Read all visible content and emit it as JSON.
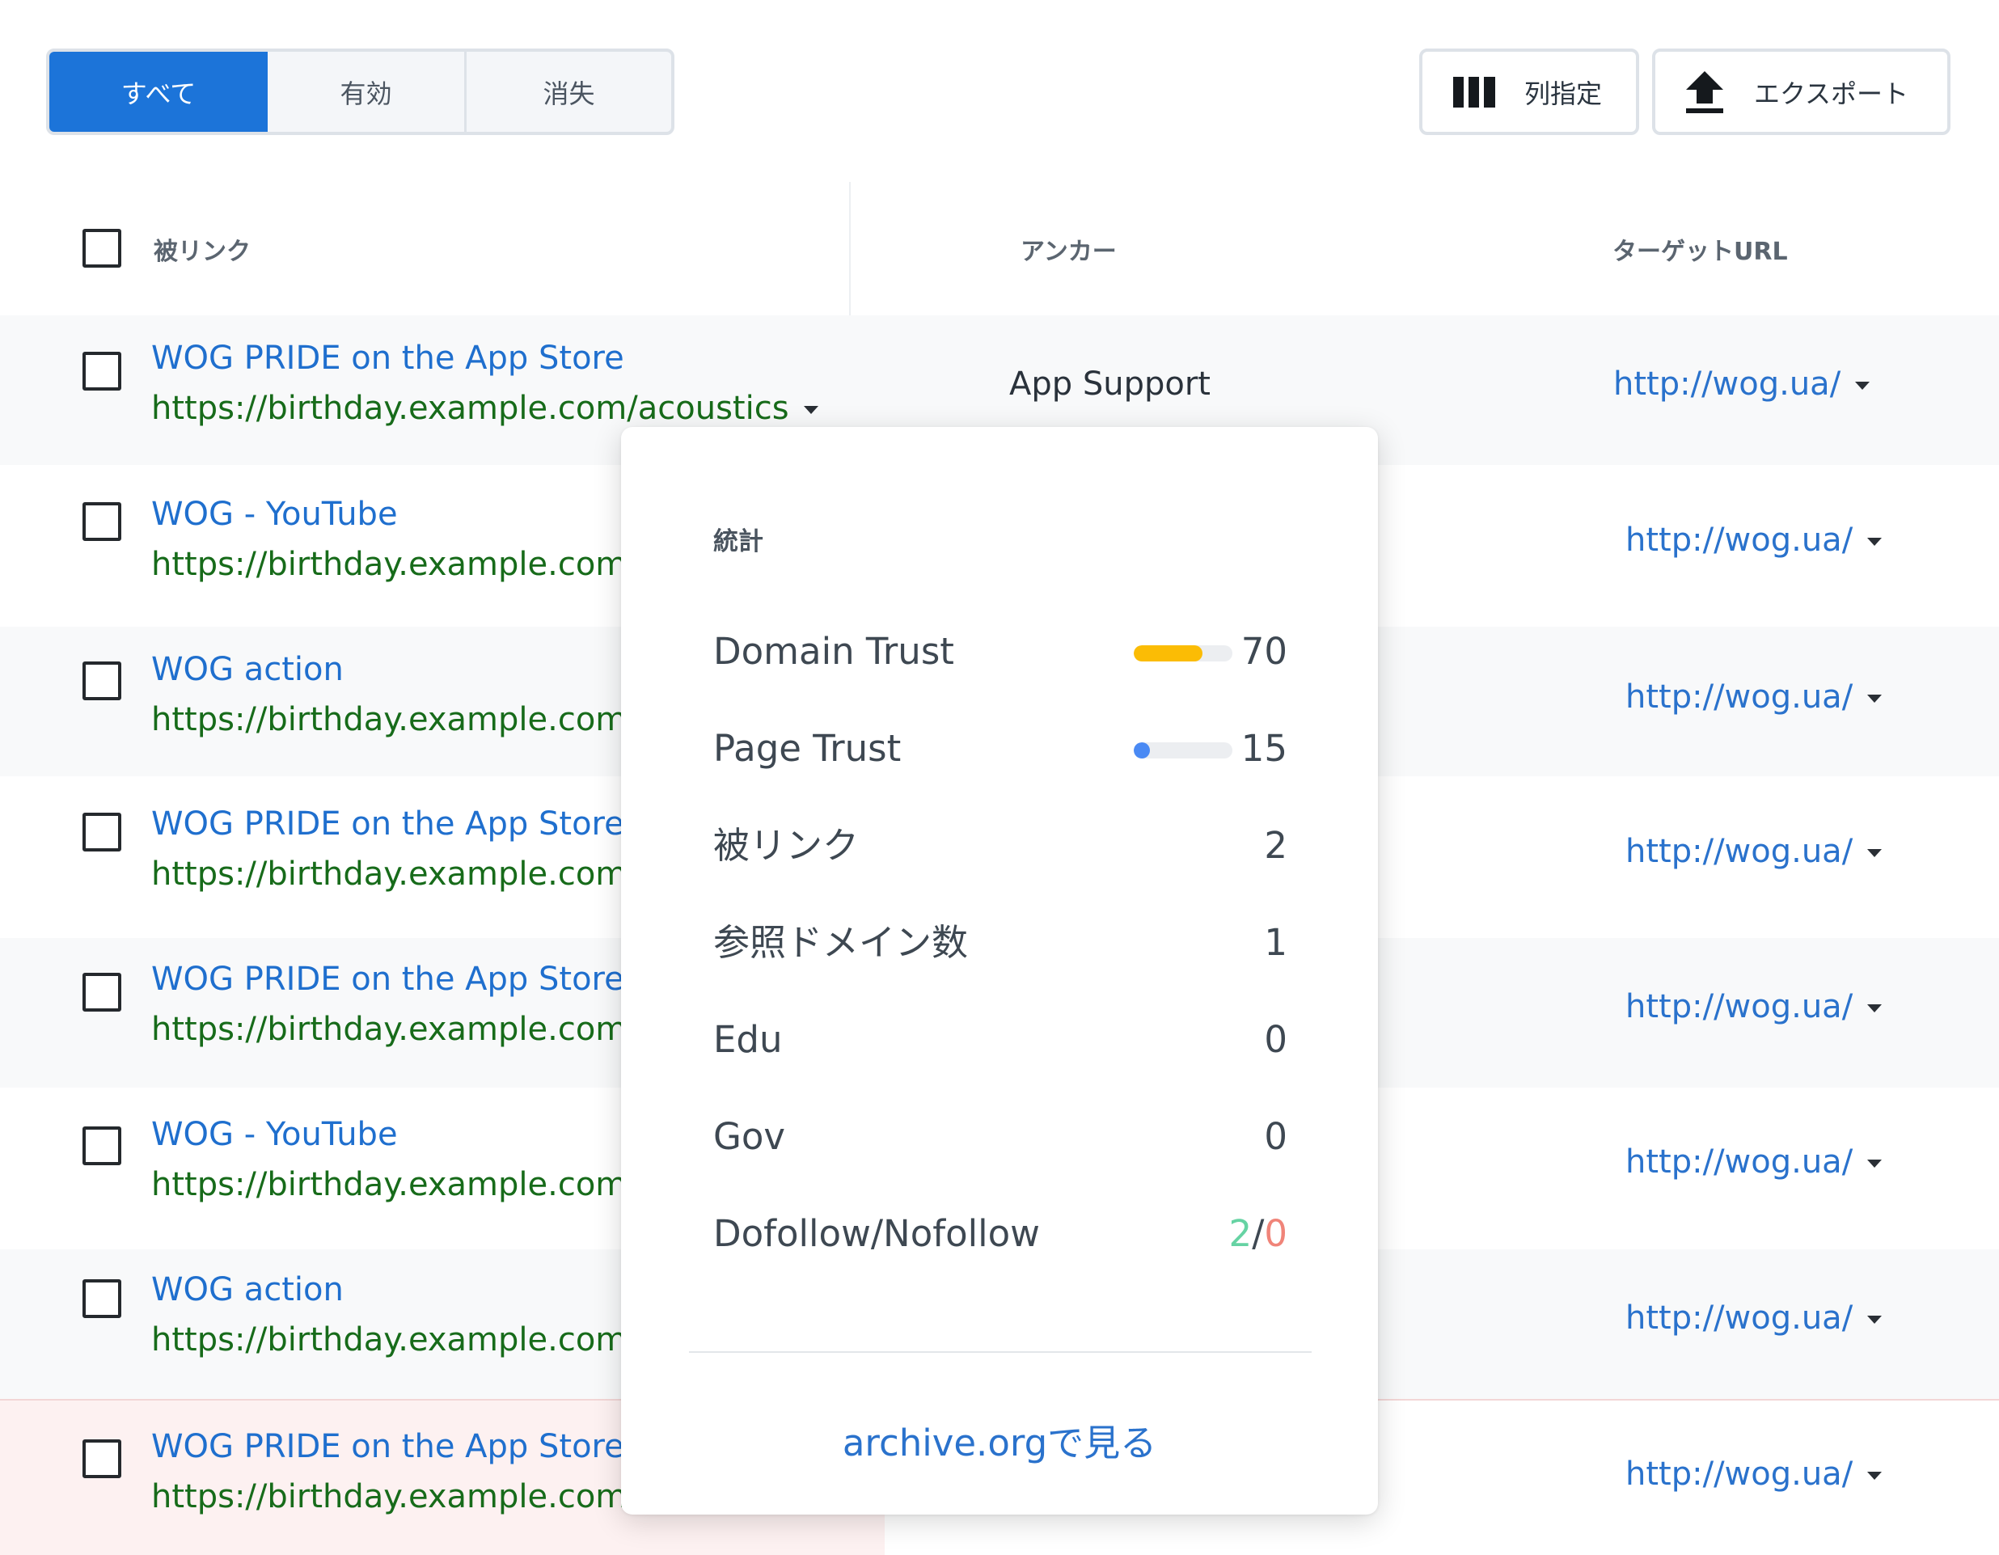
{
  "filter_tabs": [
    {
      "label": "すべて",
      "active": true
    },
    {
      "label": "有効",
      "active": false
    },
    {
      "label": "消失",
      "active": false
    }
  ],
  "toolbar": {
    "columns_label": "列指定",
    "columns_icon": "columns-icon",
    "export_label": "エクスポート",
    "export_icon": "upload-icon"
  },
  "table": {
    "headers": {
      "backlink": "被リンク",
      "anchor": "アンカー",
      "target_url": "ターゲットURL"
    },
    "rows": [
      {
        "title": "WOG PRIDE on the App Store",
        "url": "https://birthday.example.com/acoustics",
        "anchor": "App Support",
        "target": "http://wog.ua/"
      },
      {
        "title": "WOG - YouTube",
        "url": "https://birthday.example.com/",
        "anchor": "",
        "target": "http://wog.ua/"
      },
      {
        "title": "WOG action",
        "url": "https://birthday.example.com/",
        "anchor": "",
        "target": "http://wog.ua/"
      },
      {
        "title": "WOG PRIDE on the App Store",
        "url": "https://birthday.example.com/",
        "anchor": "",
        "target": "http://wog.ua/"
      },
      {
        "title": "WOG PRIDE on the App Store",
        "url": "https://birthday.example.com/",
        "anchor": "",
        "target": "http://wog.ua/"
      },
      {
        "title": "WOG - YouTube",
        "url": "https://birthday.example.com/",
        "anchor": "",
        "target": "http://wog.ua/"
      },
      {
        "title": "WOG action",
        "url": "https://birthday.example.com/",
        "anchor": "",
        "target": "http://wog.ua/"
      },
      {
        "title": "WOG PRIDE on the App Store",
        "url": "https://birthday.example.com/",
        "anchor": "",
        "target": "http://wog.ua/"
      }
    ]
  },
  "popup": {
    "title": "統計",
    "stats": [
      {
        "label": "Domain Trust",
        "value": "70",
        "bar_fraction": 0.7,
        "bar_color": "#fbbc05"
      },
      {
        "label": "Page Trust",
        "value": "15",
        "bar_fraction": 0.15,
        "bar_color": "#4a8af4"
      },
      {
        "label": "被リンク",
        "value": "2"
      },
      {
        "label": "参照ドメイン数",
        "value": "1"
      },
      {
        "label": "Edu",
        "value": "0"
      },
      {
        "label": "Gov",
        "value": "0"
      }
    ],
    "dofollow": {
      "label": "Dofollow/Nofollow",
      "dofollow": "2",
      "separator": "/",
      "nofollow": "0"
    },
    "archive_link": "archive.orgで見る"
  },
  "colors": {
    "accent": "#1c74d9",
    "link": "#2a72cc",
    "url_green": "#176b1a",
    "dofollow_green": "#66d3a3",
    "nofollow_red": "#f08479"
  }
}
